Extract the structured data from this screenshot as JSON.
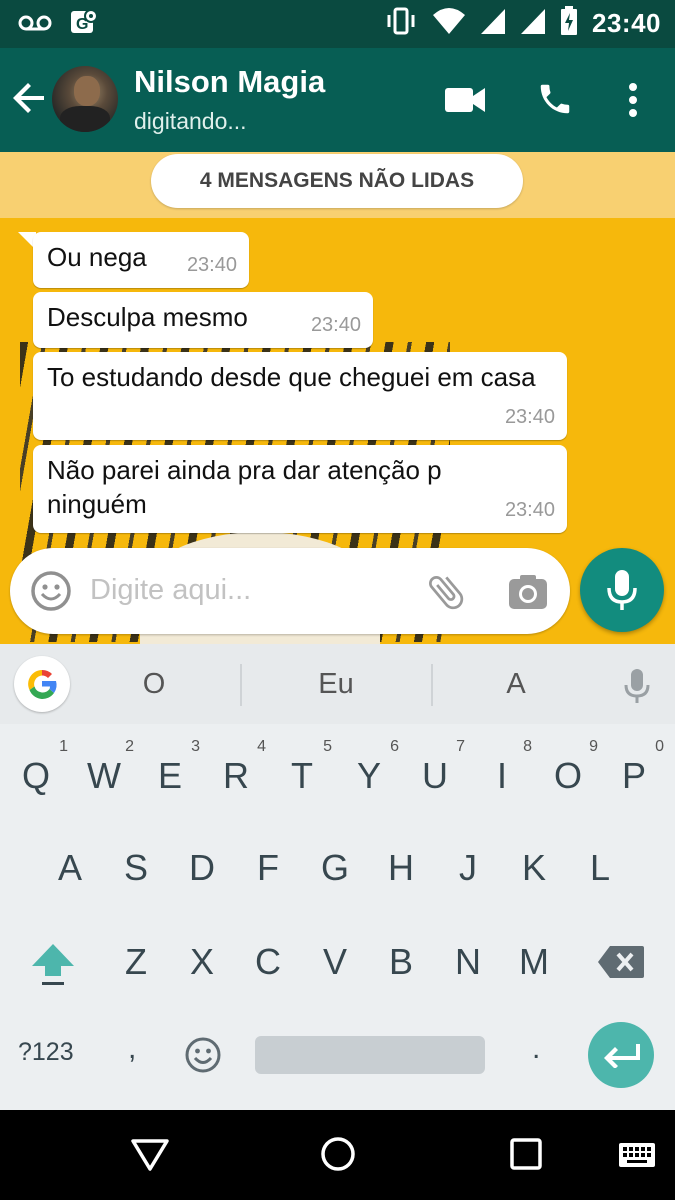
{
  "status_bar": {
    "time": "23:40",
    "icons": [
      "voicemail-icon",
      "location-sync-icon",
      "vibrate-icon",
      "wifi-icon",
      "signal-icon",
      "signal-icon",
      "battery-charging-icon"
    ]
  },
  "header": {
    "contact_name": "Nilson Magia",
    "status": "digitando...",
    "actions": [
      "video-call-icon",
      "phone-icon",
      "more-vert-icon"
    ]
  },
  "chat": {
    "unread_banner": "4 MENSAGENS NÃO LIDAS",
    "messages": [
      {
        "text": "Ou nega",
        "time": "23:40"
      },
      {
        "text": "Desculpa mesmo",
        "time": "23:40"
      },
      {
        "text": "To estudando desde que cheguei em casa",
        "time": "23:40"
      },
      {
        "text": "Não parei ainda pra dar atenção p ninguém",
        "time": "23:40"
      }
    ]
  },
  "composer": {
    "placeholder": "Digite aqui..."
  },
  "keyboard": {
    "suggestions": [
      "O",
      "Eu",
      "A"
    ],
    "row1": [
      {
        "key": "Q",
        "hint": "1"
      },
      {
        "key": "W",
        "hint": "2"
      },
      {
        "key": "E",
        "hint": "3"
      },
      {
        "key": "R",
        "hint": "4"
      },
      {
        "key": "T",
        "hint": "5"
      },
      {
        "key": "Y",
        "hint": "6"
      },
      {
        "key": "U",
        "hint": "7"
      },
      {
        "key": "I",
        "hint": "8"
      },
      {
        "key": "O",
        "hint": "9"
      },
      {
        "key": "P",
        "hint": "0"
      }
    ],
    "row2": [
      "A",
      "S",
      "D",
      "F",
      "G",
      "H",
      "J",
      "K",
      "L"
    ],
    "row3": [
      "Z",
      "X",
      "C",
      "V",
      "B",
      "N",
      "M"
    ],
    "symbols_label": "?123",
    "comma_label": ",",
    "period_label": "."
  },
  "colors": {
    "header": "#075e54",
    "status_bar": "#0a4a40",
    "chat_background": "#f6b80c",
    "accent": "#128c7e",
    "enter_key": "#4db6ac"
  }
}
